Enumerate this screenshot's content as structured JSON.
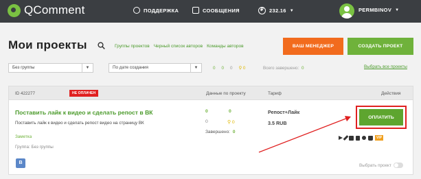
{
  "header": {
    "logo_text": "QComment",
    "nav": {
      "support": "ПОДДЕРЖКА",
      "messages": "СООБЩЕНИЯ",
      "balance": "232.16",
      "balance_icon": "₽",
      "username": "PERMBINOV"
    }
  },
  "page": {
    "title": "Мои проекты",
    "links": [
      "Группы проектов",
      "Черный список авторов",
      "Команды авторов"
    ],
    "manager_button": "ВАШ МЕНЕДЖЕР",
    "create_button": "СОЗДАТЬ ПРОЕКТ"
  },
  "filters": {
    "group_select": "Без группы",
    "sort_select": "По дате создания",
    "counts": [
      "0",
      "0",
      "0",
      "0"
    ],
    "total_label": "Всего завершено:",
    "total_value": "0",
    "select_all": "Выбрать все проекты"
  },
  "project": {
    "id_label": "ID  422277",
    "status_badge": "НЕ ОПЛАЧЕН",
    "col_data": "Данные по проекту",
    "col_tariff": "Тариф",
    "col_actions": "Действия",
    "title": "Поставить лайк к видео и сделать репост в ВК",
    "description": "Поставить лайк к видео и сделать репост видео на страницу ВК",
    "note": "Заметка",
    "group": "Группа: Без группы",
    "data_values": [
      "0",
      "0",
      "0",
      "0"
    ],
    "done_label": "Завершено:",
    "done_value": "0",
    "tariff_name": "Репост+Лайк",
    "tariff_price": "3.5 RUB",
    "pay_button": "ОПЛАТИТЬ",
    "vip_badge": "VIP",
    "vk_badge": "В",
    "choose_label": "Выбрать проект"
  },
  "colors": {
    "header_bg": "#3b3e42",
    "accent_green": "#6fb23b",
    "accent_orange": "#f26b1d",
    "alert_red": "#e02020"
  }
}
